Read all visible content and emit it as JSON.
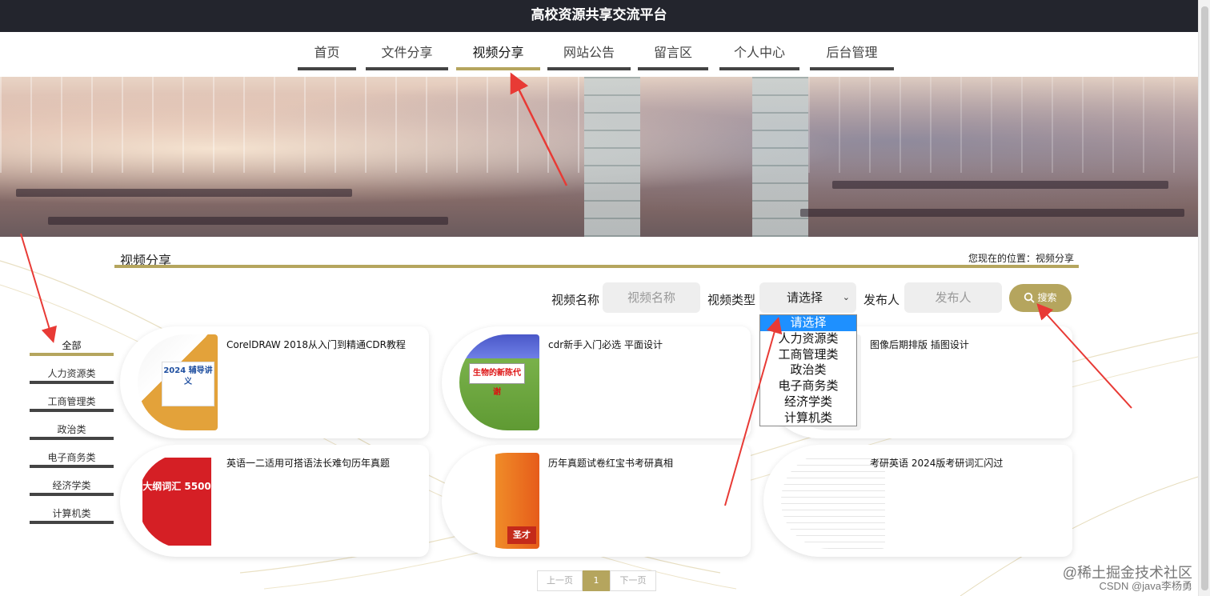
{
  "header": {
    "title": "高校资源共享交流平台"
  },
  "nav": {
    "items": [
      {
        "label": "首页"
      },
      {
        "label": "文件分享"
      },
      {
        "label": "视频分享",
        "active": true
      },
      {
        "label": "网站公告"
      },
      {
        "label": "留言区"
      },
      {
        "label": "个人中心"
      },
      {
        "label": "后台管理"
      }
    ]
  },
  "section": {
    "title": "视频分享",
    "location": "您现在的位置：视频分享"
  },
  "filters": {
    "name_label": "视频名称",
    "name_placeholder": "视频名称",
    "type_label": "视频类型",
    "type_selected": "请选择",
    "publisher_label": "发布人",
    "publisher_placeholder": "发布人",
    "search_label": "搜索",
    "type_options": [
      "请选择",
      "人力资源类",
      "工商管理类",
      "政治类",
      "电子商务类",
      "经济学类",
      "计算机类"
    ]
  },
  "sidebar": {
    "categories": [
      {
        "label": "全部",
        "active": true
      },
      {
        "label": "人力资源类"
      },
      {
        "label": "工商管理类"
      },
      {
        "label": "政治类"
      },
      {
        "label": "电子商务类"
      },
      {
        "label": "经济学类"
      },
      {
        "label": "计算机类"
      }
    ]
  },
  "cards": [
    {
      "title": "CorelDRAW 2018从入门到精通CDR教程",
      "thumb_text": "2024 辅导讲义"
    },
    {
      "title": "cdr新手入门必选 平面设计",
      "thumb_text": "生物的新陈代谢"
    },
    {
      "title": "图像后期排版 插图设计",
      "thumb_text": ""
    },
    {
      "title": "英语一二适用可搭语法长难句历年真题",
      "thumb_text": "大纲词汇 5500"
    },
    {
      "title": "历年真题试卷红宝书考研真相",
      "thumb_text": "圣才"
    },
    {
      "title": "考研英语 2024版考研词汇闪过",
      "thumb_text": ""
    }
  ],
  "pagination": {
    "prev": "上一页",
    "current": "1",
    "next": "下一页"
  },
  "watermarks": {
    "line1": "@稀土掘金技术社区",
    "line2": "CSDN @java李杨勇"
  },
  "colors": {
    "accent": "#b5a55e",
    "header_bg": "#23252d",
    "select_highlight": "#1e90ff"
  }
}
